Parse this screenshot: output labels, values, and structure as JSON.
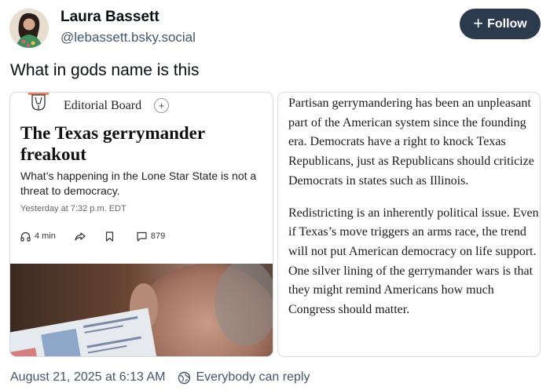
{
  "author": {
    "name": "Laura Bassett",
    "handle": "@lebassett.bsky.social"
  },
  "follow_label": "Follow",
  "post_text": "What in gods name is this",
  "article": {
    "section": "Editorial Board",
    "headline": "The Texas gerrymander freakout",
    "dek": "What’s happening in the Lone Star State is not a threat to democracy.",
    "timestamp": "Yesterday at 7:32 p.m. EDT",
    "listen_time": "4 min",
    "comments_count": "879",
    "paragraphs": [
      "Partisan gerrymandering has been an unpleasant part of the American system since the founding era. Democrats have a right to knock Texas Republicans, just as Republicans should criticize Democrats in states such as Illinois.",
      "Redistricting is an inherently political issue. Even if Texas’s move triggers an arms race, the trend will not put American democracy on life support. One silver lining of the gerrymander wars is that they might remind Americans how much Congress should matter."
    ]
  },
  "footer": {
    "date": "August 21, 2025 at 6:13 AM",
    "reply_setting": "Everybody can reply"
  },
  "colors": {
    "follow_bg": "#2b3a4c",
    "handle_gray": "#42576c",
    "border": "#d4dbe2"
  }
}
